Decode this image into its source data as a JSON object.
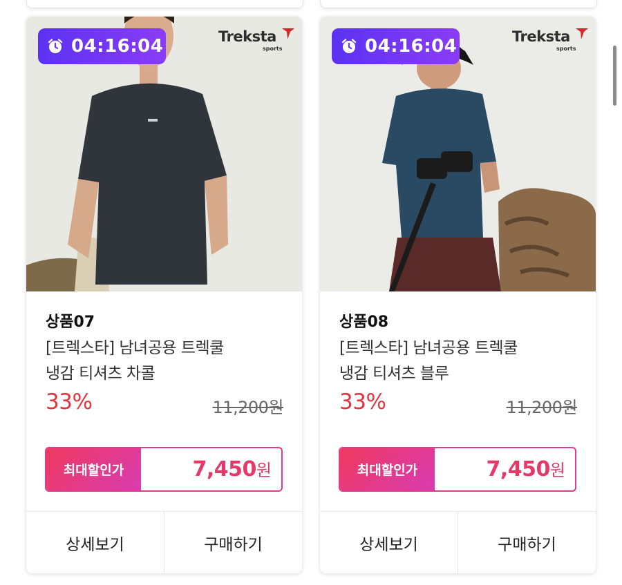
{
  "products": [
    {
      "timer": "04:16:04",
      "brand": "Treksta",
      "brand_sub": "sports",
      "code": "상품07",
      "name_line1": "[트렉스타] 남녀공용 트렉쿨",
      "name_line2": "냉감 티셔츠 차콜",
      "discount": "33%",
      "original_price": "11,200원",
      "max_label": "최대할인가",
      "max_price": "7,450",
      "currency": "원",
      "detail_label": "상세보기",
      "buy_label": "구매하기"
    },
    {
      "timer": "04:16:04",
      "brand": "Treksta",
      "brand_sub": "sports",
      "code": "상품08",
      "name_line1": "[트렉스타] 남녀공용 트렉쿨",
      "name_line2": "냉감 티셔츠 블루",
      "discount": "33%",
      "original_price": "11,200원",
      "max_label": "최대할인가",
      "max_price": "7,450",
      "currency": "원",
      "detail_label": "상세보기",
      "buy_label": "구매하기"
    }
  ],
  "colors": {
    "timer_gradient": [
      "#5b32f2",
      "#8a3cf6"
    ],
    "discount": "#e0353e",
    "max_border": "#e43a8a",
    "max_label_gradient": [
      "#ee3a5e",
      "#d93bb2"
    ],
    "shirt_charcoal": "#2f353b",
    "shirt_blue": "#2a4a63"
  }
}
